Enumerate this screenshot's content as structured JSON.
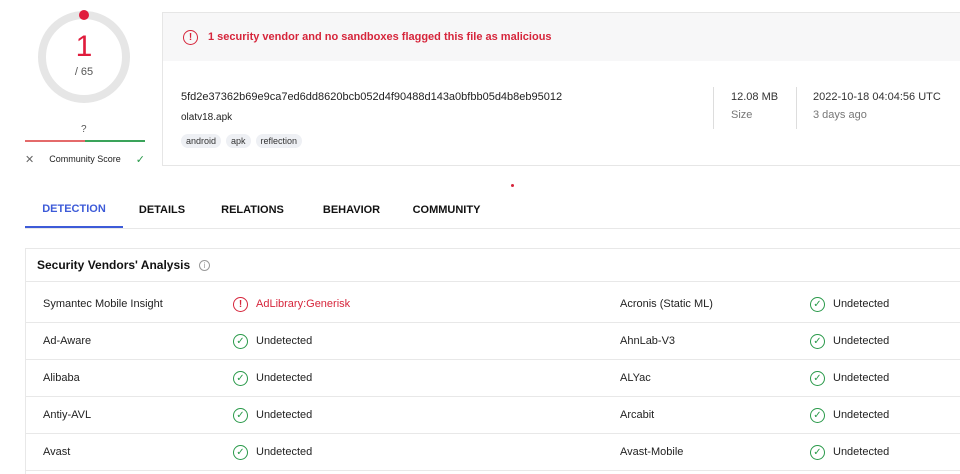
{
  "score": {
    "detections": "1",
    "total": "/ 65"
  },
  "community": {
    "score_value": "?",
    "label": "Community Score",
    "negative_icon": "close-icon",
    "positive_icon": "check-icon"
  },
  "alert": {
    "icon": "alert-circle-icon",
    "text": "1 security vendor and no sandboxes flagged this file as malicious"
  },
  "file": {
    "hash": "5fd2e37362b69e9ca7ed6dd8620bcb052d4f90488d143a0bfbb05d4b8eb95012",
    "name": "olatv18.apk",
    "tags": [
      "android",
      "apk",
      "reflection"
    ],
    "size_value": "12.08 MB",
    "size_label": "Size",
    "date_value": "2022-10-18 04:04:56 UTC",
    "date_relative": "3 days ago"
  },
  "tabs": [
    "DETECTION",
    "DETAILS",
    "RELATIONS",
    "BEHAVIOR",
    "COMMUNITY"
  ],
  "section": {
    "title": "Security Vendors' Analysis",
    "info_icon": "info-icon"
  },
  "vendors": [
    {
      "left_name": "Symantec Mobile Insight",
      "left_result": "AdLibrary:Generisk",
      "left_status": "malicious",
      "right_name": "Acronis (Static ML)",
      "right_result": "Undetected",
      "right_status": "undetected"
    },
    {
      "left_name": "Ad-Aware",
      "left_result": "Undetected",
      "left_status": "undetected",
      "right_name": "AhnLab-V3",
      "right_result": "Undetected",
      "right_status": "undetected"
    },
    {
      "left_name": "Alibaba",
      "left_result": "Undetected",
      "left_status": "undetected",
      "right_name": "ALYac",
      "right_result": "Undetected",
      "right_status": "undetected"
    },
    {
      "left_name": "Antiy-AVL",
      "left_result": "Undetected",
      "left_status": "undetected",
      "right_name": "Arcabit",
      "right_result": "Undetected",
      "right_status": "undetected"
    },
    {
      "left_name": "Avast",
      "left_result": "Undetected",
      "left_status": "undetected",
      "right_name": "Avast-Mobile",
      "right_result": "Undetected",
      "right_status": "undetected"
    }
  ],
  "colors": {
    "malicious": "#d6253b",
    "undetected": "#2a9a4a",
    "accent": "#3d5bd8"
  }
}
